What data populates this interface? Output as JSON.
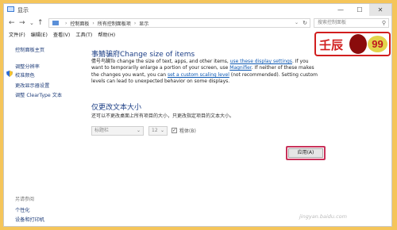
{
  "window": {
    "title": "显示",
    "controls": {
      "minimize": "—",
      "maximize": "☐",
      "close": "✕"
    }
  },
  "address_bar": {
    "nav": {
      "back": "←",
      "forward": "→",
      "recent": "⌄",
      "up": "↑"
    },
    "breadcrumb": [
      "控制面板",
      "所有控制面板项",
      "显示"
    ],
    "search_placeholder": "搜索控制面板"
  },
  "menu": [
    "文件(F)",
    "编辑(E)",
    "查看(V)",
    "工具(T)",
    "帮助(H)"
  ],
  "sidebar": {
    "items": [
      {
        "label": "控制面板主页"
      },
      {
        "label": "调整分辨率"
      },
      {
        "label": "校准颜色"
      },
      {
        "label": "更改显示器设置"
      },
      {
        "label": "调整 ClearType 文本"
      }
    ],
    "see_also": {
      "heading": "另请参阅",
      "items": [
        {
          "label": "个性化"
        },
        {
          "label": "设备和打印机"
        }
      ]
    }
  },
  "main": {
    "heading": "事鲭骗府Change size of items",
    "para_prefix": "倩号鸟躏",
    "para_1": "To change the size of text, apps, and other items, ",
    "link_1": "use these display settings",
    "para_2": ".  If you want to temporarily enlarge a portion of your screen, use ",
    "link_2": "Magnifier",
    "para_3": ".  If neither of these makes the changes you want, you can ",
    "link_3": "set a custom scaling level",
    "para_4": " (not recommended).  Setting custom levels can lead to unexpected behavior on some displays.",
    "text_size": {
      "heading": "仅更改文本大小",
      "description": "还可以不更改桌面上所有项目的大小，只更改指定项目的文本大小。",
      "item_select": "标题栏",
      "size_select": "12",
      "bold_label": "粗体(B)",
      "bold_checked": "✓"
    },
    "apply_button": "应用(A)"
  },
  "stamp": {
    "name": "壬辰",
    "number": "99"
  },
  "watermark": "jingyan.baidu.com",
  "colors": {
    "frame": "#f5c55a",
    "heading": "#1d3f86",
    "link": "#0a57b3",
    "apply_highlight": "#c8325a"
  }
}
